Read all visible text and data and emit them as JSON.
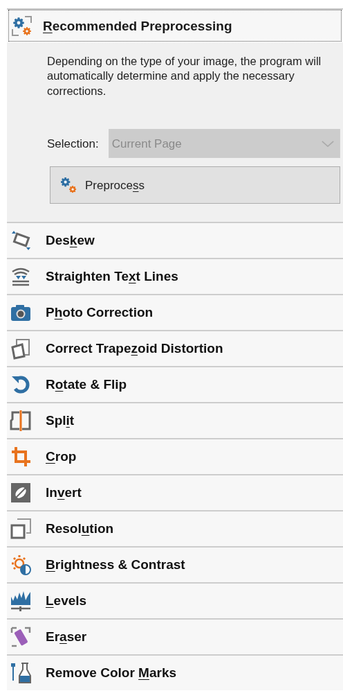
{
  "section": {
    "access_key": "R",
    "text_after": "ecommended Preprocessing",
    "expanded": true,
    "focused": true,
    "description": "Depending on the type of your image, the program will automatically determine and apply the necessary corrections.",
    "selection": {
      "label": "Selection:",
      "value": "Current Page",
      "disabled": true
    },
    "button": {
      "text_before": "Preproce",
      "access_key": "s",
      "text_after": "s"
    }
  },
  "items": [
    {
      "text_before": "Des",
      "access_key": "k",
      "text_after": "ew"
    },
    {
      "text_before": "Straighten Te",
      "access_key": "x",
      "text_after": "t Lines"
    },
    {
      "text_before": "P",
      "access_key": "h",
      "text_after": "oto Correction"
    },
    {
      "text_before": "Correct Trape",
      "access_key": "z",
      "text_after": "oid Distortion"
    },
    {
      "text_before": "R",
      "access_key": "o",
      "text_after": "tate & Flip"
    },
    {
      "text_before": "Spl",
      "access_key": "i",
      "text_after": "t"
    },
    {
      "access_key": "C",
      "text_after": "rop"
    },
    {
      "text_before": "In",
      "access_key": "v",
      "text_after": "ert"
    },
    {
      "text_before": "Resol",
      "access_key": "u",
      "text_after": "tion"
    },
    {
      "access_key": "B",
      "text_after": "rightness & Contrast"
    },
    {
      "access_key": "L",
      "text_after": "evels"
    },
    {
      "text_before": "Er",
      "access_key": "a",
      "text_after": "ser"
    },
    {
      "text_before": "Remove Color ",
      "access_key": "M",
      "text_after": "arks"
    }
  ]
}
